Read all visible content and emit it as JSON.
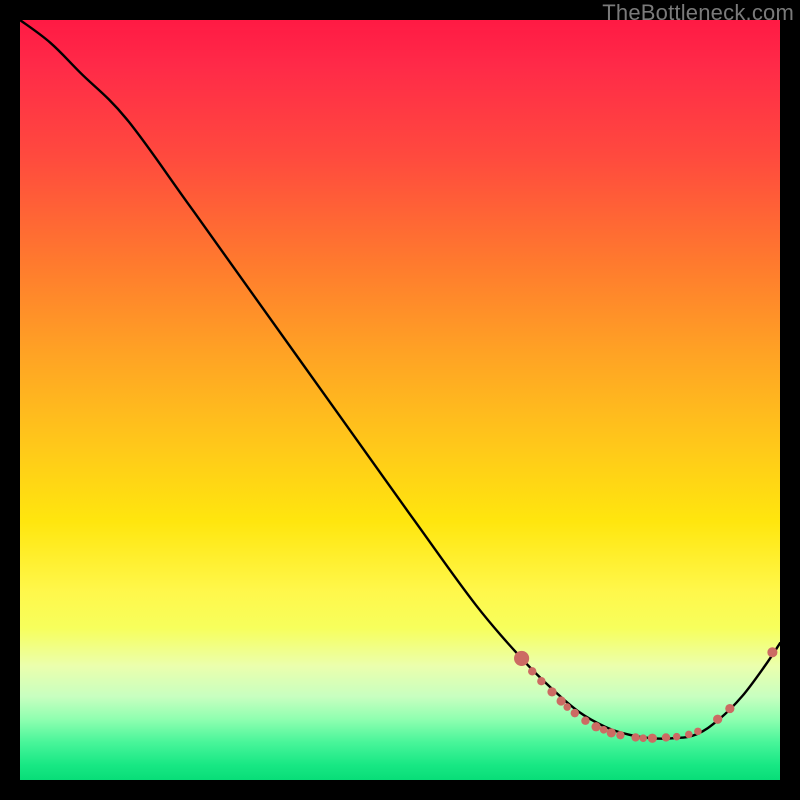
{
  "watermark": "TheBottleneck.com",
  "colors": {
    "curve_stroke": "#000000",
    "dot_fill": "#cc6b63",
    "dot_stroke": "#8a3c38"
  },
  "chart_data": {
    "type": "line",
    "title": "",
    "xlabel": "",
    "ylabel": "",
    "xlim": [
      0,
      100
    ],
    "ylim": [
      0,
      100
    ],
    "series": [
      {
        "name": "bottleneck-curve",
        "x": [
          0,
          4,
          8,
          14,
          22,
          32,
          42,
          52,
          60,
          66,
          70,
          73.5,
          77,
          80,
          83,
          86,
          89,
          92,
          95,
          98,
          100
        ],
        "y": [
          100,
          97,
          93,
          87,
          76,
          62,
          48,
          34,
          23,
          16,
          12,
          9,
          7,
          6,
          5.5,
          5.5,
          6,
          8,
          11,
          15,
          18
        ]
      }
    ],
    "scatter": {
      "name": "marked-points",
      "points": [
        {
          "x": 66.0,
          "y": 16.0,
          "r": 1.8
        },
        {
          "x": 67.4,
          "y": 14.3,
          "r": 1.0
        },
        {
          "x": 68.6,
          "y": 13.0,
          "r": 1.0
        },
        {
          "x": 70.0,
          "y": 11.6,
          "r": 1.1
        },
        {
          "x": 71.2,
          "y": 10.4,
          "r": 1.1
        },
        {
          "x": 72.0,
          "y": 9.6,
          "r": 0.9
        },
        {
          "x": 73.0,
          "y": 8.8,
          "r": 1.0
        },
        {
          "x": 74.4,
          "y": 7.8,
          "r": 1.0
        },
        {
          "x": 75.8,
          "y": 7.0,
          "r": 1.1
        },
        {
          "x": 76.8,
          "y": 6.6,
          "r": 0.9
        },
        {
          "x": 77.8,
          "y": 6.2,
          "r": 1.1
        },
        {
          "x": 79.0,
          "y": 5.9,
          "r": 1.0
        },
        {
          "x": 81.0,
          "y": 5.6,
          "r": 1.0
        },
        {
          "x": 82.0,
          "y": 5.5,
          "r": 0.9
        },
        {
          "x": 83.2,
          "y": 5.5,
          "r": 1.1
        },
        {
          "x": 85.0,
          "y": 5.6,
          "r": 1.0
        },
        {
          "x": 86.4,
          "y": 5.7,
          "r": 0.9
        },
        {
          "x": 88.0,
          "y": 6.0,
          "r": 0.9
        },
        {
          "x": 89.2,
          "y": 6.4,
          "r": 0.9
        },
        {
          "x": 91.8,
          "y": 8.0,
          "r": 1.1
        },
        {
          "x": 93.4,
          "y": 9.4,
          "r": 1.1
        },
        {
          "x": 99.0,
          "y": 16.8,
          "r": 1.2
        }
      ]
    }
  }
}
